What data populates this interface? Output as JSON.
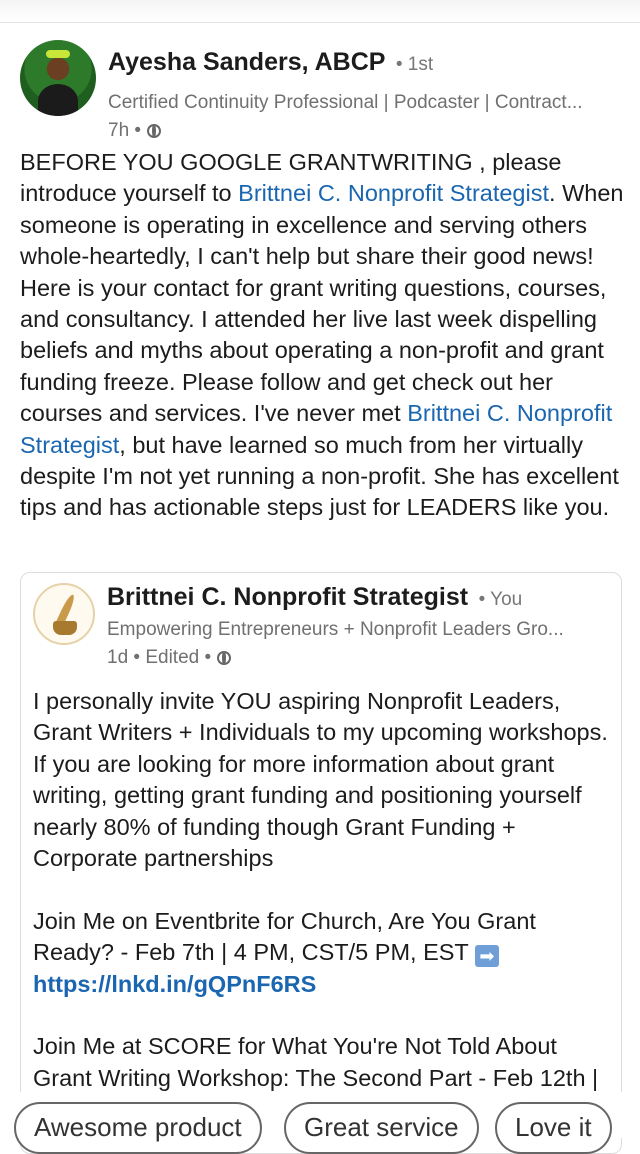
{
  "post": {
    "author": {
      "name": "Ayesha Sanders, ABCP",
      "degree": "• 1st",
      "headline": "Certified Continuity Professional | Podcaster | Contract...",
      "meta": "7h •"
    },
    "body": {
      "p1": "BEFORE YOU GOOGLE GRANTWRITING , please introduce yourself to ",
      "mention1": "Brittnei C. Nonprofit Strategist",
      "p2": ". When someone is operating in excellence and serving others whole-heartedly, I can't help but share their good news! Here is your contact for grant writing questions, courses, and consultancy. I attended her live last week dispelling beliefs and myths about operating a non-profit and grant funding freeze. Please follow and get check out her courses and services. I've never met ",
      "mention2": "Brittnei C. Nonprofit Strategist",
      "p3": ", but have learned so much from her virtually despite I'm not yet running a non-profit. She has excellent tips and has actionable steps just for LEADERS like you."
    }
  },
  "repost": {
    "author": {
      "name": "Brittnei C. Nonprofit Strategist",
      "you": "• You",
      "headline": "Empowering Entrepreneurs + Nonprofit Leaders Gro...",
      "meta": "1d • Edited •"
    },
    "body": {
      "para1": "I personally invite YOU aspiring Nonprofit Leaders, Grant Writers + Individuals to my upcoming workshops. If you are looking for more information about grant writing, getting grant funding and positioning yourself nearly 80% of funding though Grant Funding + Corporate partnerships",
      "para2": "Join Me on Eventbrite for Church, Are You Grant Ready? - Feb 7th | 4 PM, CST/5 PM, EST ",
      "arrow": "➡",
      "link1": "https://lnkd.in/gQPnF6RS",
      "para3": "Join Me at SCORE for What You're Not Told About Grant Writing Workshop: The Second Part - Feb 12th |"
    }
  },
  "reply_chips": [
    "Awesome product",
    "Great service",
    "Love it"
  ],
  "colors": {
    "link": "#1a66b0",
    "text": "#1c1c1c",
    "meta": "#707070"
  }
}
